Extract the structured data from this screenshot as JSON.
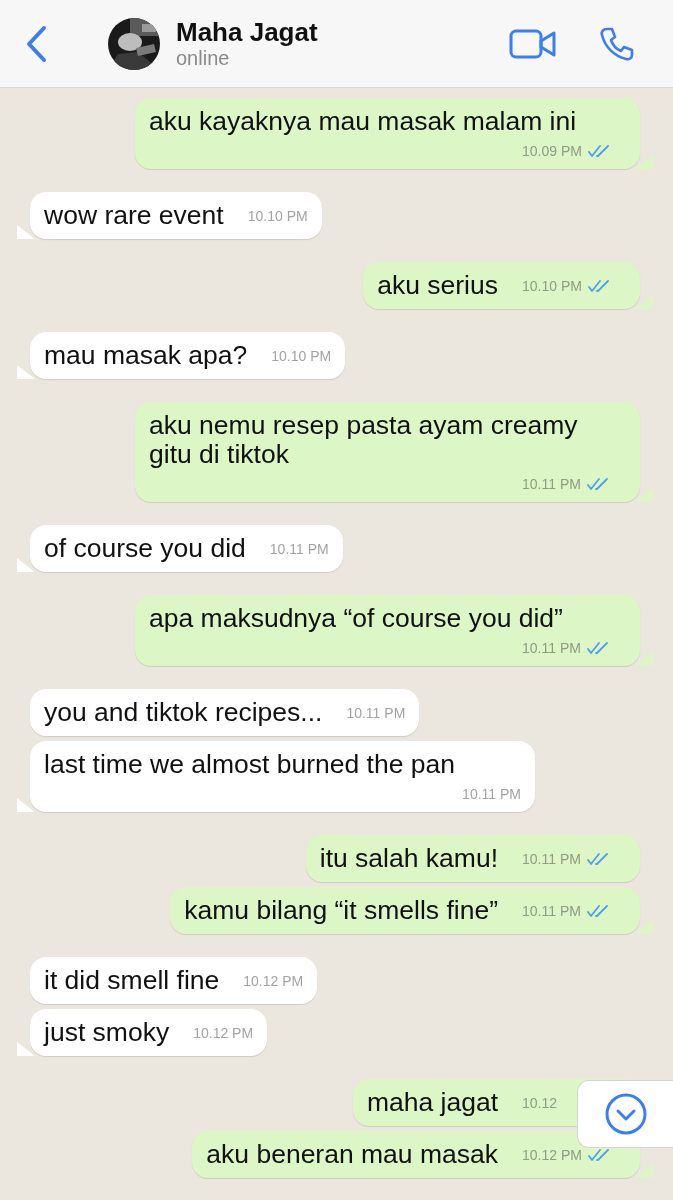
{
  "header": {
    "name": "Maha Jagat",
    "status": "online"
  },
  "messages": [
    {
      "kind": "outgoing",
      "text": "aku kayaknya mau masak malam ini",
      "time": "10.09 PM",
      "read": true,
      "tail": true
    },
    {
      "kind": "incoming",
      "text": "wow rare event",
      "time": "10.10 PM",
      "tail": true
    },
    {
      "kind": "outgoing",
      "text": "aku serius",
      "time": "10.10 PM",
      "read": true,
      "tail": true
    },
    {
      "kind": "incoming",
      "text": "mau masak apa?",
      "time": "10.10 PM",
      "tail": true
    },
    {
      "kind": "outgoing",
      "text": "aku nemu resep pasta ayam creamy gitu di tiktok",
      "time": "10.11 PM",
      "read": true,
      "tail": true
    },
    {
      "kind": "incoming",
      "text": "of course you did",
      "time": "10.11 PM",
      "tail": true
    },
    {
      "kind": "outgoing",
      "text": "apa maksudnya “of course you did”",
      "time": "10.11 PM",
      "read": true,
      "tail": true
    },
    {
      "kind": "incoming",
      "text": "you and tiktok recipes...",
      "time": "10.11 PM",
      "tail": false
    },
    {
      "kind": "incoming",
      "text": "last time we almost burned the pan",
      "time": "10.11 PM",
      "tail": true
    },
    {
      "kind": "outgoing",
      "text": "itu salah kamu!",
      "time": "10.11 PM",
      "read": true,
      "tail": false
    },
    {
      "kind": "outgoing",
      "text": "kamu bilang “it smells fine”",
      "time": "10.11 PM",
      "read": true,
      "tail": true
    },
    {
      "kind": "incoming",
      "text": "it did smell fine",
      "time": "10.12 PM",
      "tail": false
    },
    {
      "kind": "incoming",
      "text": "just smoky",
      "time": "10.12 PM",
      "tail": true
    },
    {
      "kind": "outgoing",
      "text": "maha jagat",
      "time": "10.12"
    },
    {
      "kind": "outgoing",
      "text": "aku beneran mau masak",
      "time": "10.12 PM",
      "read": true,
      "tail": true
    }
  ]
}
